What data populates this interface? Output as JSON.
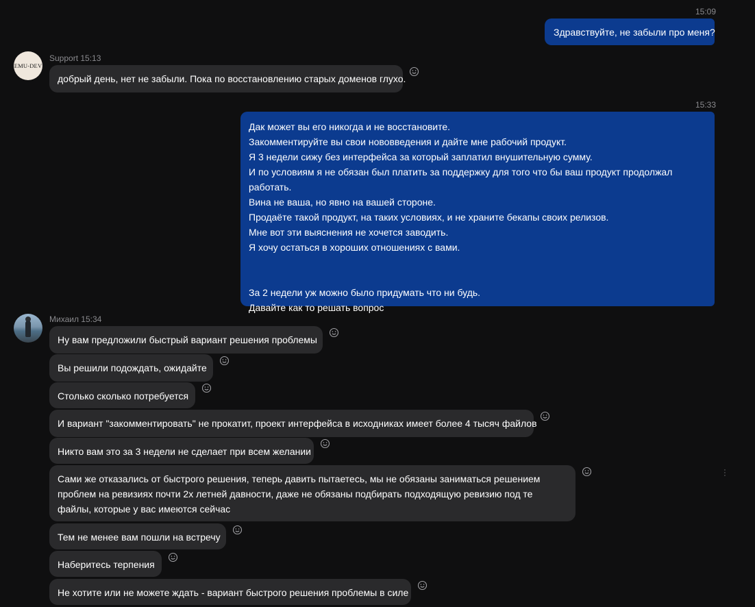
{
  "messages": {
    "out1": {
      "time": "15:09",
      "text": "Здравствуйте, не забыли про меня?"
    },
    "support": {
      "sender": "Support 15:13",
      "avatar_text": "EMU-DEV",
      "text": "добрый день, нет не забыли. Пока по восстановлению старых доменов глухо."
    },
    "out2": {
      "time": "15:33",
      "lines": [
        "Дак может вы его никогда и не восстановите.",
        "Закомментируйте  вы свои нововведения и дайте мне рабочий продукт.",
        "Я 3 недели сижу без интерфейса за который заплатил внушительную сумму.",
        "И по условиям я не обязан был платить за поддержку для того что бы ваш продукт продолжал работать.",
        "Вина не ваша, но явно на вашей стороне.",
        "Продаёте такой продукт, на таких условиях, и не храните бекапы своих релизов.",
        "Мне вот эти выяснения не хочется заводить.",
        "Я хочу остаться в хороших отношениях с вами."
      ],
      "lines_after": [
        "За 2 недели уж можно было придумать что ни будь.",
        "Давайте как то решать вопрос"
      ]
    },
    "mikhail": {
      "sender": "Михаил 15:34",
      "items": [
        "Ну вам предложили быстрый вариант решения проблемы",
        "Вы решили подождать, ожидайте",
        "Столько сколько потребуется",
        "И вариант \"закомментировать\" не прокатит, проект интерфейса в исходниках имеет более 4 тысяч файлов",
        "Никто вам это за 3 недели не сделает при всем желании",
        "Сами же отказались от быстрого решения, теперь давить пытаетесь, мы не обязаны заниматься решением проблем на ревизиях почти 2х летней давности, даже не обязаны подбирать подходящую ревизию под те файлы, которые у вас имеются сейчас",
        "Тем не менее вам пошли на встречу",
        "Наберитесь терпения",
        "Не хотите или не можете ждать - вариант быстрого решения проблемы в силе"
      ]
    }
  },
  "icons": {
    "reaction": "smiley-icon",
    "menu": "more-vertical-icon"
  },
  "colors": {
    "background": "#0f0f10",
    "outgoing_bubble": "#0c3b8f",
    "incoming_bubble": "#2a2a2c",
    "meta_text": "#8a8a8e"
  }
}
